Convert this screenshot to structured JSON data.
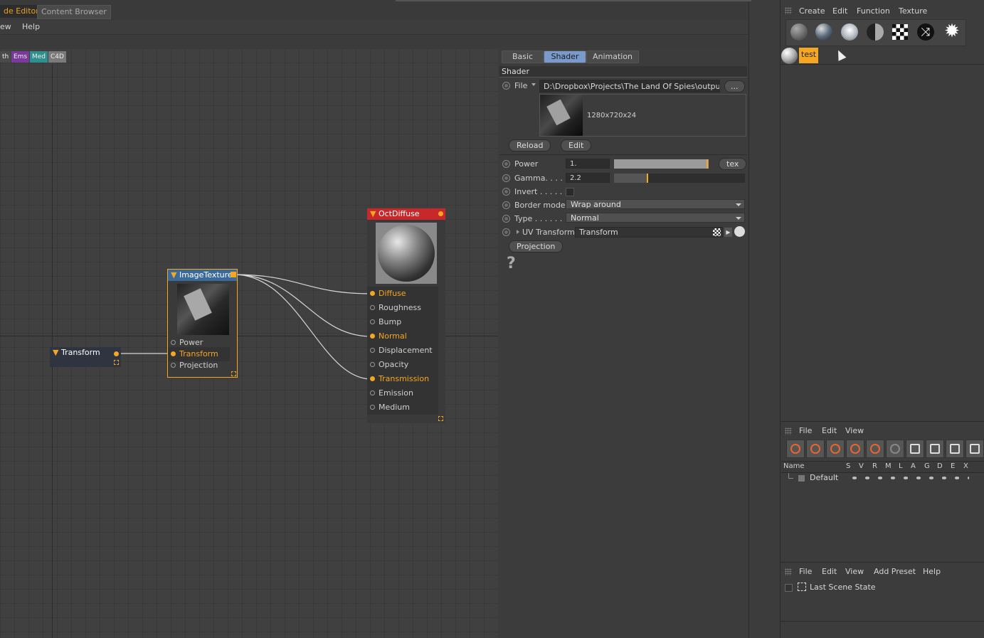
{
  "tabs": {
    "node_editor": "de Editor",
    "content_browser": "Content Browser"
  },
  "menu": {
    "view": "ew",
    "help": "Help"
  },
  "filters": [
    {
      "label": "th",
      "color": "#4a4a4a"
    },
    {
      "label": "Ems",
      "color": "#7a3a9a"
    },
    {
      "label": "Med",
      "color": "#2f8f8f"
    },
    {
      "label": "C4D",
      "color": "#7a7a7a"
    }
  ],
  "nodes": {
    "transform": {
      "title": "Transform"
    },
    "image_texture": {
      "title": "ImageTexture",
      "ports": [
        {
          "label": "Power",
          "connected": false
        },
        {
          "label": "Transform",
          "connected": true
        },
        {
          "label": "Projection",
          "connected": false
        }
      ]
    },
    "oct_diffuse": {
      "title": "OctDiffuse",
      "ports": [
        {
          "label": "Diffuse",
          "connected": true
        },
        {
          "label": "Roughness",
          "connected": false
        },
        {
          "label": "Bump",
          "connected": false
        },
        {
          "label": "Normal",
          "connected": true
        },
        {
          "label": "Displacement",
          "connected": false
        },
        {
          "label": "Opacity",
          "connected": false
        },
        {
          "label": "Transmission",
          "connected": true
        },
        {
          "label": "Emission",
          "connected": false
        },
        {
          "label": "Medium",
          "connected": false
        }
      ]
    }
  },
  "panel": {
    "tabs": [
      "Basic",
      "Shader",
      "Animation"
    ],
    "section": "Shader",
    "file_label": "File",
    "file_path": "D:\\Dropbox\\Projects\\The Land Of Spies\\output\\",
    "browse": "...",
    "resolution": "1280x720x24",
    "reload": "Reload",
    "edit": "Edit",
    "power_label": "Power",
    "power_value": "1.",
    "power_fill": 1.0,
    "tex": "tex",
    "gamma_label": "Gamma. . . . .",
    "gamma_value": "2.2",
    "gamma_fill": 0.25,
    "invert_label": "Invert . . . . . .",
    "border_label": "Border mode",
    "border_value": "Wrap around",
    "type_label": "Type . . . . . . .",
    "type_value": "Normal",
    "uv_label": "UV Transform",
    "uv_value": "Transform",
    "projection": "Projection",
    "help": "?"
  },
  "materials": {
    "menu": [
      "Create",
      "Edit",
      "Function",
      "Texture"
    ],
    "material_name": "test"
  },
  "layers": {
    "menu": [
      "File",
      "Edit",
      "View"
    ],
    "columns": [
      "Name",
      "S",
      "V",
      "R",
      "M",
      "L",
      "A",
      "G",
      "D",
      "E",
      "X"
    ],
    "row": "Default"
  },
  "states": {
    "menu": [
      "File",
      "Edit",
      "View",
      "Add Preset",
      "Help"
    ],
    "item": "Last Scene State"
  },
  "colors": {
    "accent": "#f5a623",
    "wire": "#d8d8d8",
    "diffuse_header": "#c8282a",
    "texture_header": "#3a6a9a"
  }
}
